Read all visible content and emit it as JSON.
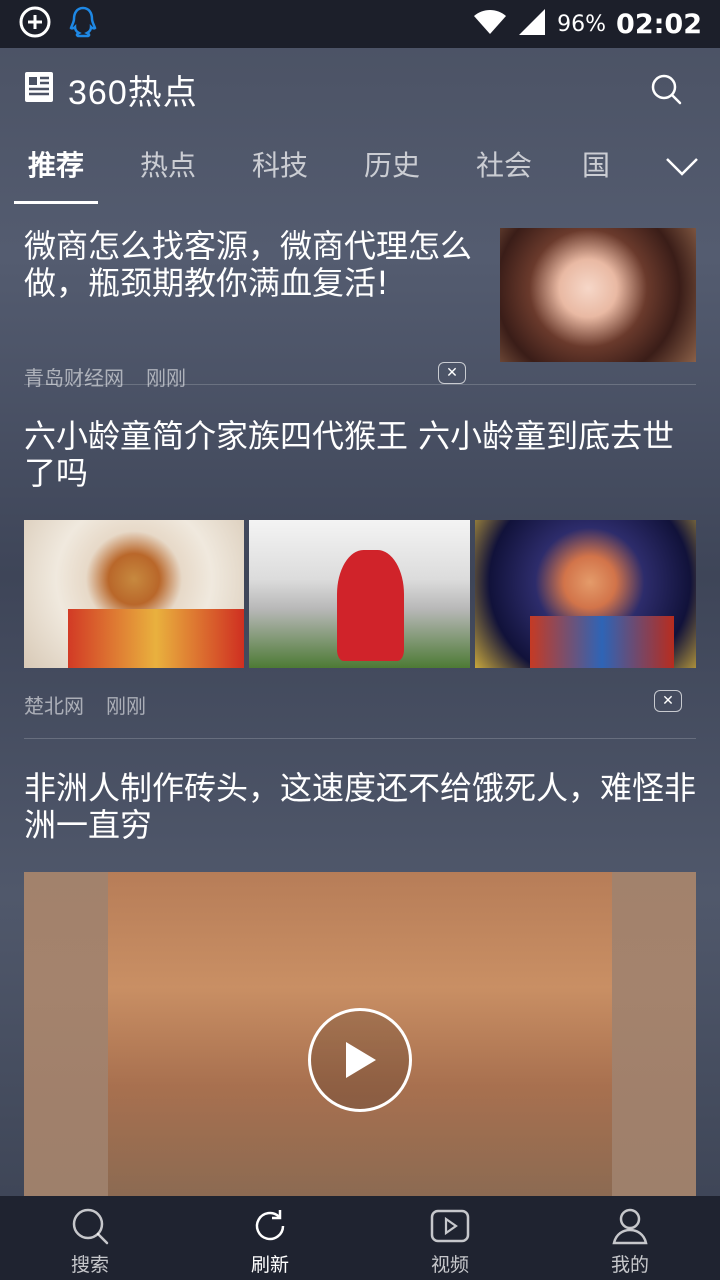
{
  "status_bar": {
    "battery_percent": "96%",
    "time": "02:02"
  },
  "header": {
    "app_title": "360热点"
  },
  "tabs": [
    {
      "label": "推荐",
      "active": true
    },
    {
      "label": "热点"
    },
    {
      "label": "科技"
    },
    {
      "label": "历史"
    },
    {
      "label": "社会"
    },
    {
      "label": "国"
    }
  ],
  "feed": [
    {
      "title": "微商怎么找客源，微商代理怎么做，瓶颈期教你满血复活!",
      "source": "青岛财经网",
      "time": "刚刚"
    },
    {
      "title": "六小龄童简介家族四代猴王 六小龄童到底去世了吗",
      "source": "楚北网",
      "time": "刚刚"
    },
    {
      "title": "非洲人制作砖头，这速度还不给饿死人，难怪非洲一直穷"
    }
  ],
  "bottom_nav": [
    {
      "label": "搜索",
      "icon": "search-icon"
    },
    {
      "label": "刷新",
      "icon": "refresh-icon",
      "active": true
    },
    {
      "label": "视频",
      "icon": "video-icon"
    },
    {
      "label": "我的",
      "icon": "profile-icon"
    }
  ]
}
